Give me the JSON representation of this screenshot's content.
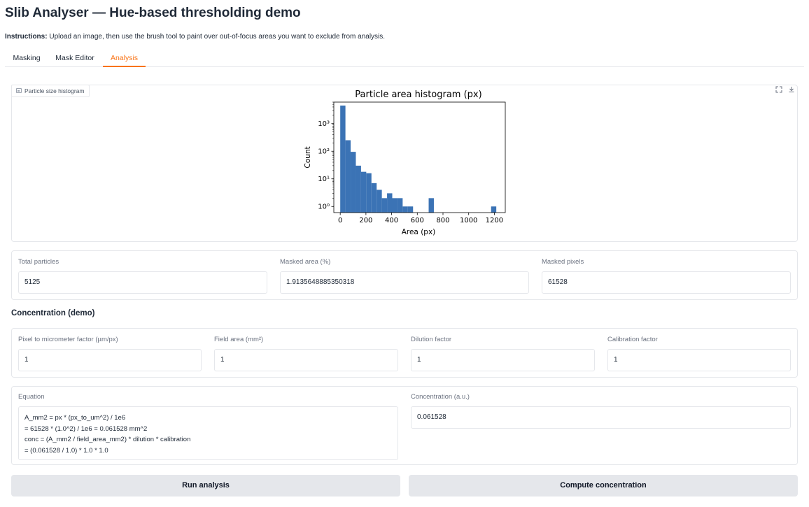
{
  "app": {
    "title": "Slib Analyser — Hue-based thresholding demo",
    "instructions_bold": "Instructions:",
    "instructions_text": " Upload an image, then use the brush tool to paint over out-of-focus areas you want to exclude from analysis."
  },
  "tabs": [
    {
      "label": "Masking",
      "active": false
    },
    {
      "label": "Mask Editor",
      "active": false
    },
    {
      "label": "Analysis",
      "active": true
    }
  ],
  "plot_block": {
    "label": "Particle size histogram",
    "fullscreen_icon": "expand-icon",
    "download_icon": "download-icon"
  },
  "chart_data": {
    "type": "bar",
    "title": "Particle area histogram (px)",
    "xlabel": "Area (px)",
    "ylabel": "Count",
    "yscale": "log",
    "xlim": [
      -50,
      1285
    ],
    "ylim": [
      0.6,
      6000
    ],
    "xticks": [
      0,
      200,
      400,
      600,
      800,
      1000,
      1200
    ],
    "xtick_labels": [
      "0",
      "200",
      "400",
      "600",
      "800",
      "1000",
      "1200"
    ],
    "yticks": [
      1,
      10,
      100,
      1000
    ],
    "ytick_labels": [
      "10⁰",
      "10¹",
      "10²",
      "10³"
    ],
    "bin_width": 40.5,
    "bins": [
      {
        "x0": 0,
        "count": 4500
      },
      {
        "x0": 40.5,
        "count": 250
      },
      {
        "x0": 81,
        "count": 95
      },
      {
        "x0": 121.5,
        "count": 30
      },
      {
        "x0": 162,
        "count": 18
      },
      {
        "x0": 202.5,
        "count": 16
      },
      {
        "x0": 243,
        "count": 7
      },
      {
        "x0": 283.5,
        "count": 4
      },
      {
        "x0": 324,
        "count": 2
      },
      {
        "x0": 364.5,
        "count": 3
      },
      {
        "x0": 405,
        "count": 2
      },
      {
        "x0": 445.5,
        "count": 2
      },
      {
        "x0": 486,
        "count": 1
      },
      {
        "x0": 526.5,
        "count": 1
      },
      {
        "x0": 688.5,
        "count": 2
      },
      {
        "x0": 1174.5,
        "count": 1
      }
    ],
    "bar_color": "#3b73b5"
  },
  "stats": {
    "total_particles": {
      "label": "Total particles",
      "value": "5125"
    },
    "masked_area": {
      "label": "Masked area (%)",
      "value": "1.9135648885350318"
    },
    "masked_pixels": {
      "label": "Masked pixels",
      "value": "61528"
    }
  },
  "concentration": {
    "section_title": "Concentration (demo)",
    "pixel_factor": {
      "label": "Pixel to micrometer factor (µm/px)",
      "value": "1"
    },
    "field_area": {
      "label": "Field area (mm²)",
      "value": "1"
    },
    "dilution": {
      "label": "Dilution factor",
      "value": "1"
    },
    "calibration": {
      "label": "Calibration factor",
      "value": "1"
    },
    "equation": {
      "label": "Equation",
      "lines": [
        "A_mm2 = px * (px_to_um^2) / 1e6",
        "= 61528 * (1.0^2) / 1e6 = 0.061528 mm^2",
        "conc = (A_mm2 / field_area_mm2) * dilution * calibration",
        "= (0.061528 / 1.0) * 1.0 * 1.0"
      ]
    },
    "result": {
      "label": "Concentration (a.u.)",
      "value": "0.061528"
    }
  },
  "buttons": {
    "run_analysis": "Run analysis",
    "compute_concentration": "Compute concentration"
  }
}
